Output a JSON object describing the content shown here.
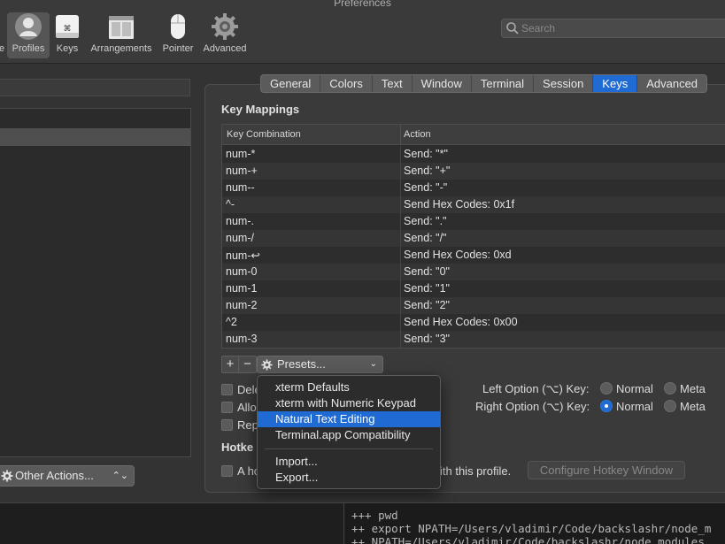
{
  "window": {
    "title": "Preferences"
  },
  "toolbar": {
    "items": [
      {
        "label": "Profiles"
      },
      {
        "label": "Keys"
      },
      {
        "label": "Arrangements"
      },
      {
        "label": "Pointer"
      },
      {
        "label": "Advanced"
      }
    ],
    "partial_prev_label": "e",
    "selected_index": 0
  },
  "search": {
    "placeholder": "Search"
  },
  "left_panel": {
    "other_actions_label": "Other Actions..."
  },
  "tabs": [
    "General",
    "Colors",
    "Text",
    "Window",
    "Terminal",
    "Session",
    "Keys",
    "Advanced"
  ],
  "active_tab": "Keys",
  "key_mappings": {
    "title": "Key Mappings",
    "headers": [
      "Key Combination",
      "Action"
    ],
    "rows": [
      [
        "num-*",
        "Send: \"*\""
      ],
      [
        "num-+",
        "Send: \"+\""
      ],
      [
        "num--",
        "Send: \"-\""
      ],
      [
        "^-",
        "Send Hex Codes: 0x1f"
      ],
      [
        "num-.",
        "Send: \".\""
      ],
      [
        "num-/",
        "Send: \"/\""
      ],
      [
        "num-↩",
        "Send Hex Codes: 0xd"
      ],
      [
        "num-0",
        "Send: \"0\""
      ],
      [
        "num-1",
        "Send: \"1\""
      ],
      [
        "num-2",
        "Send: \"2\""
      ],
      [
        "^2",
        "Send Hex Codes: 0x00"
      ],
      [
        "num-3",
        "Send: \"3\""
      ]
    ],
    "add_label": "+",
    "remove_label": "−",
    "presets_label": "Presets..."
  },
  "checkboxes": [
    {
      "label": "Dele"
    },
    {
      "label": "Allo"
    },
    {
      "label": "Rep"
    }
  ],
  "options": {
    "left_label": "Left Option (⌥) Key:",
    "right_label": "Right Option (⌥) Key:",
    "normal_label": "Normal",
    "meta_label": "Meta",
    "left_selected": "none",
    "right_selected": "Normal"
  },
  "hotkey": {
    "title": "Hotke",
    "checkbox_label": "A ho",
    "checkbox_label_tail": "ith this profile.",
    "configure_label": "Configure Hotkey Window"
  },
  "presets_menu": {
    "items": [
      "xterm Defaults",
      "xterm with Numeric Keypad",
      "Natural Text Editing",
      "Terminal.app Compatibility"
    ],
    "highlighted": "Natural Text Editing",
    "secondary_items": [
      "Import...",
      "Export..."
    ]
  },
  "terminal": {
    "lines": [
      "+++ pwd",
      "++ export NPATH=/Users/vladimir/Code/backslashr/node_m",
      "++ NPATH=/Users/vladimir/Code/backslashr/node_modules"
    ]
  },
  "colors": {
    "accent": "#1f6ad3",
    "background": "#333333"
  }
}
